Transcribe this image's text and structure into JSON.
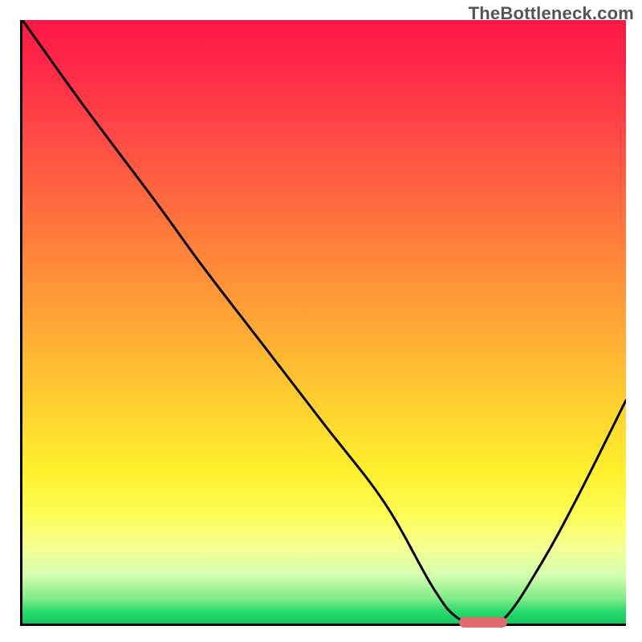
{
  "watermark": "TheBottleneck.com",
  "chart_data": {
    "type": "line",
    "title": "",
    "xlabel": "",
    "ylabel": "",
    "xlim": [
      0,
      100
    ],
    "ylim": [
      0,
      100
    ],
    "grid": false,
    "legend": false,
    "series": [
      {
        "name": "bottleneck-curve",
        "x": [
          0,
          10,
          22,
          30,
          40,
          50,
          60,
          68,
          72,
          76,
          80,
          86,
          92,
          100
        ],
        "y": [
          100,
          86,
          70,
          59,
          46,
          33,
          20,
          6,
          1,
          0,
          1,
          10,
          21,
          37
        ]
      }
    ],
    "marker": {
      "name": "optimal-range",
      "x_start": 72,
      "x_end": 80,
      "y": 0.5,
      "color": "#e06a6d"
    },
    "background": "vertical spectrum gradient red (top, high bottleneck) to green (bottom, low bottleneck)"
  }
}
